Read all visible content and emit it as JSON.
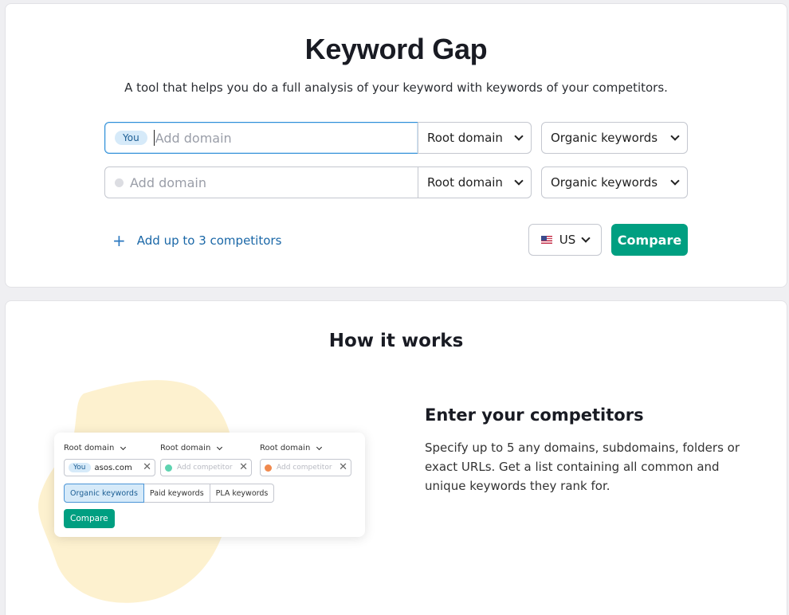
{
  "header": {
    "title": "Keyword Gap",
    "subtitle": "A tool that helps you do a full analysis of your keyword with keywords of your competitors."
  },
  "form": {
    "rows": [
      {
        "badge": "You",
        "placeholder": "Add domain",
        "domain_type": "Root domain",
        "keyword_type": "Organic keywords"
      },
      {
        "placeholder": "Add domain",
        "domain_type": "Root domain",
        "keyword_type": "Organic keywords"
      }
    ],
    "add_competitors_label": "Add up to 3 competitors",
    "country": "US",
    "compare_label": "Compare"
  },
  "how_it_works": {
    "title": "How it works",
    "preview": {
      "columns": [
        "Root domain",
        "Root domain",
        "Root domain"
      ],
      "inputs": [
        {
          "badge": "You",
          "value": "asos.com"
        },
        {
          "placeholder": "Add competitor",
          "dot_color": "#5ed3b0"
        },
        {
          "placeholder": "Add competitor",
          "dot_color": "#f0894d"
        }
      ],
      "tabs": [
        "Organic keywords",
        "Paid keywords",
        "PLA keywords"
      ],
      "compare_label": "Compare"
    },
    "step_title": "Enter your competitors",
    "step_text": "Specify up to 5 any domains, subdomains, folders or exact URLs. Get a list containing all common and unique keywords they rank for."
  },
  "colors": {
    "accent": "#009f81",
    "link": "#1a67a7",
    "focus": "#2e8fd8",
    "blob": "#fdf1cf"
  }
}
